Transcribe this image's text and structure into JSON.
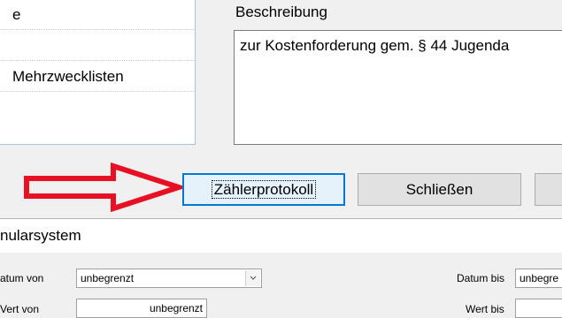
{
  "dialog": {
    "list_items": [
      "e",
      "",
      "Mehrzwecklisten"
    ],
    "description_label": "Beschreibung",
    "description_text": "zur Kostenforderung gem. § 44 Jugenda"
  },
  "buttons": {
    "zaehlerprotokoll": "Zählerprotokoll",
    "schliessen": "Schließen",
    "third": ""
  },
  "annotation": {
    "arrow_color": "#e81123",
    "icon": "red-arrow-pointing-right"
  },
  "lower_window": {
    "title": "nularsystem",
    "filters": {
      "datum_von_label": "atum von",
      "datum_von_value": "unbegrenzt",
      "datum_bis_label": "Datum bis",
      "datum_bis_value": "unbegre",
      "wert_von_label": "Vert von",
      "wert_von_value": "unbegrenzt",
      "wert_bis_label": "Wert bis",
      "wert_bis_value": ""
    }
  }
}
